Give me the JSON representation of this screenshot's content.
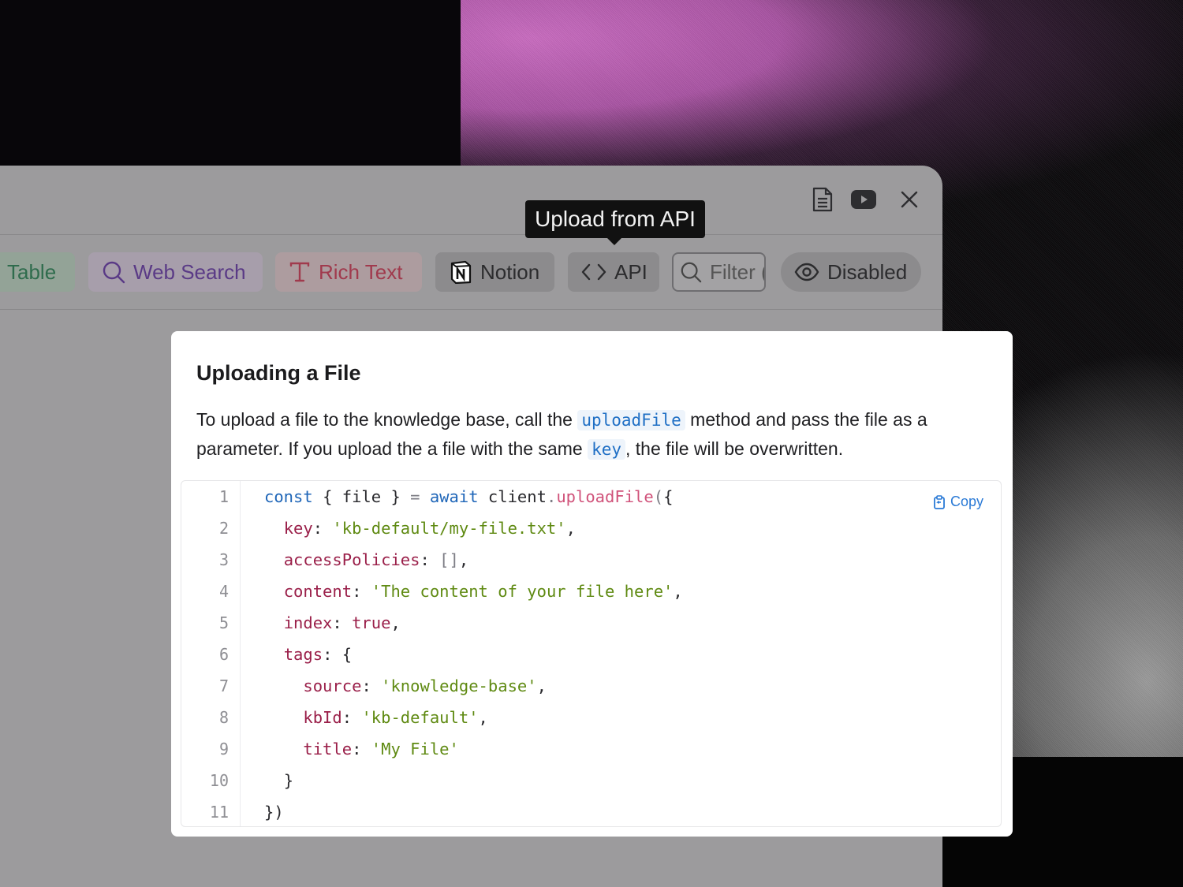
{
  "tooltip": {
    "text": "Upload from API"
  },
  "window_icons": [
    "document-icon",
    "youtube-icon",
    "close-icon"
  ],
  "tabs": [
    {
      "label": "Table",
      "icon": "table-icon",
      "color": "#2f6c4d"
    },
    {
      "label": "Web Search",
      "icon": "search-icon",
      "color": "#5a3a86"
    },
    {
      "label": "Rich Text",
      "icon": "text-icon",
      "color": "#a03a4d"
    },
    {
      "label": "Notion",
      "icon": "notion-icon",
      "color": "#2c2c2e"
    },
    {
      "label": "API",
      "icon": "code-icon",
      "color": "#2c2c2e"
    },
    {
      "label": "Filter (",
      "icon": "search-icon",
      "color": "#555555"
    },
    {
      "label": "Disabled",
      "icon": "eye-icon",
      "color": "#2c2c2e"
    }
  ],
  "card": {
    "title": "Uploading a File",
    "desc_part1": "To upload a file to the knowledge base, call the ",
    "desc_code1": "uploadFile",
    "desc_part2": " method and pass the file as a parameter. If you upload the a file with the same ",
    "desc_code2": "key",
    "desc_part3": ", the file will be overwritten.",
    "copy_label": "Copy",
    "line_numbers": [
      "1",
      "2",
      "3",
      "4",
      "5",
      "6",
      "7",
      "8",
      "9",
      "10",
      "11"
    ],
    "code_lines": [
      "const { file } = await client.uploadFile({",
      "  key: 'kb-default/my-file.txt',",
      "  accessPolicies: [],",
      "  content: 'The content of your file here',",
      "  index: true,",
      "  tags: {",
      "    source: 'knowledge-base',",
      "    kbId: 'kb-default',",
      "    title: 'My File'",
      "  }",
      "})"
    ]
  },
  "colors": {
    "keyword": "#1f66b8",
    "function": "#d0527a",
    "property": "#9a1f49",
    "string": "#5f8a12",
    "link": "#2a7ad6"
  }
}
